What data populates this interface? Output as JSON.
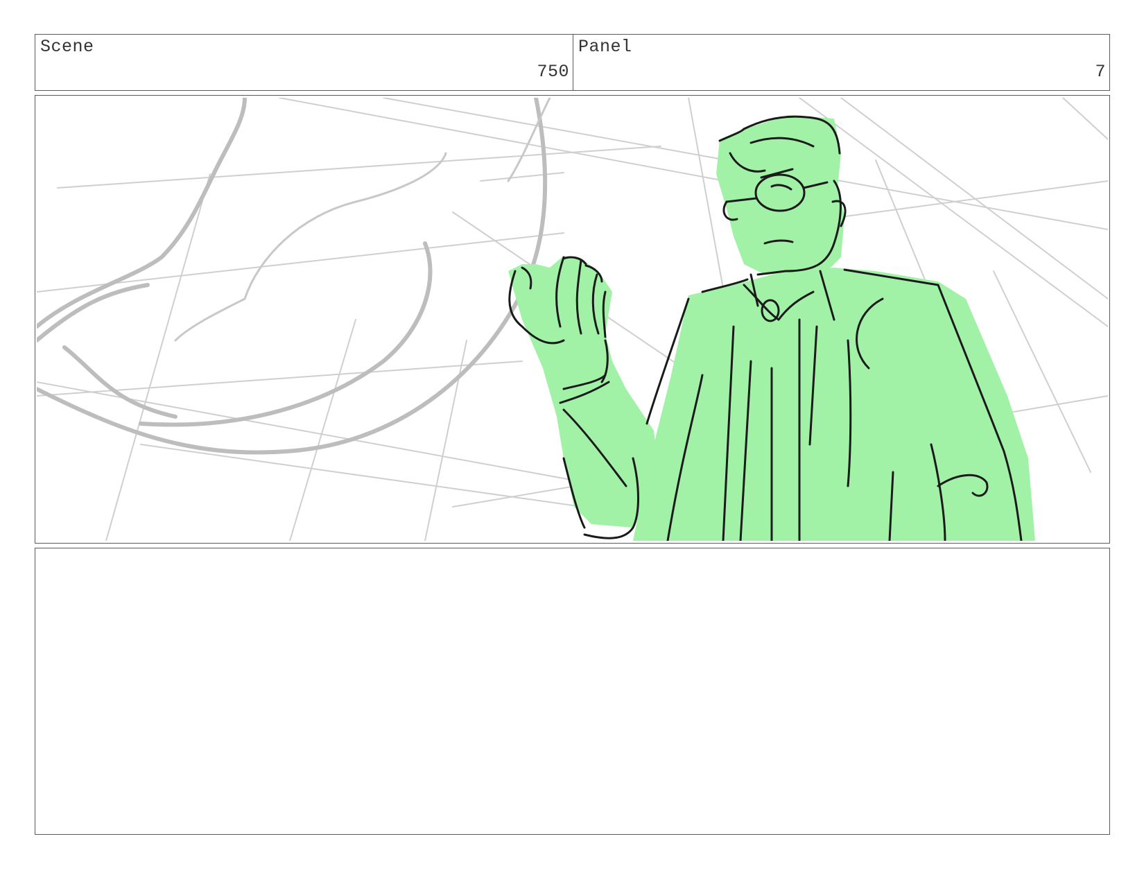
{
  "header": {
    "scene_label": "Scene",
    "scene_number": "750",
    "panel_label": "Panel",
    "panel_number": "7"
  },
  "artwork": {
    "fill_color": "#a1f2a7",
    "line_color": "#1a1a1a",
    "background_sketch_color": "#c4c4c4"
  },
  "notes": {
    "text": ""
  }
}
